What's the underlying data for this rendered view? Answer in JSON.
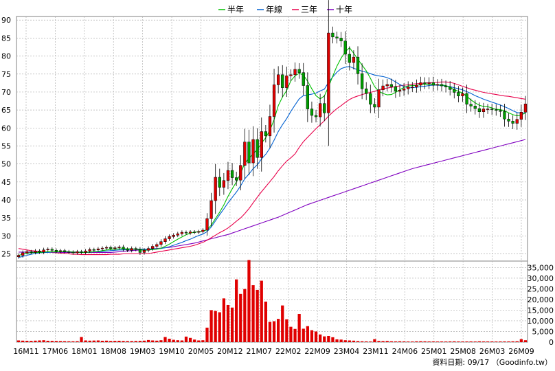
{
  "legend": [
    {
      "label": "半年",
      "color": "#00c000"
    },
    {
      "label": "年線",
      "color": "#0060d0"
    },
    {
      "label": "三年",
      "color": "#e8004a"
    },
    {
      "label": "十年",
      "color": "#8000c0"
    }
  ],
  "footer": {
    "source_label": "資料日期: 09/17 （Goodinfo.tw）"
  },
  "chart_data": {
    "type": "candlestick",
    "price_axis": {
      "range": [
        23,
        91
      ],
      "ticks": [
        25,
        30,
        35,
        40,
        45,
        50,
        55,
        60,
        65,
        70,
        75,
        80,
        85,
        90
      ]
    },
    "volume_axis": {
      "range": [
        0,
        38000
      ],
      "ticks": [
        0,
        5000,
        10000,
        15000,
        20000,
        25000,
        30000,
        35000
      ],
      "tick_labels": [
        "0",
        "5,000",
        "10,000",
        "15,000",
        "20,000",
        "25,000",
        "30,000",
        "35,000"
      ]
    },
    "x_labels": [
      "16M11",
      "17M06",
      "18M01",
      "18M08",
      "19M03",
      "19M10",
      "20M05",
      "20M12",
      "21M07",
      "22M02",
      "22M09",
      "23M04",
      "23M11",
      "24M06",
      "25M01",
      "25M08",
      "26M03",
      "26M09"
    ],
    "close": [
      24.6,
      25.3,
      25.6,
      25.4,
      25.8,
      25.5,
      26.1,
      26.3,
      26.0,
      25.7,
      25.9,
      25.6,
      25.5,
      25.3,
      25.6,
      25.4,
      25.8,
      26.2,
      26.1,
      26.4,
      26.6,
      26.8,
      26.5,
      26.7,
      26.9,
      26.3,
      26.0,
      26.5,
      26.2,
      25.4,
      26.0,
      26.5,
      27.1,
      27.6,
      28.4,
      29.2,
      29.8,
      30.2,
      30.6,
      31.0,
      30.8,
      31.1,
      31.0,
      31.2,
      31.6,
      34.8,
      39.8,
      46.3,
      43.5,
      45.4,
      48.2,
      46.2,
      45.5,
      49.6,
      56.1,
      50.3,
      56.8,
      51.8,
      59.0,
      57.8,
      63.2,
      72.0,
      74.8,
      71.2,
      74.5,
      74.8,
      76.3,
      75.4,
      71.8,
      65.3,
      63.5,
      63.1,
      66.8,
      64.2,
      86.4,
      85.3,
      85.0,
      84.2,
      80.5,
      78.2,
      79.7,
      75.1,
      70.9,
      69.6,
      66.6,
      65.8,
      70.6,
      71.7,
      72.1,
      71.5,
      70.2,
      70.5,
      70.9,
      71.4,
      71.4,
      71.9,
      72.6,
      72.3,
      72.6,
      71.9,
      72.1,
      71.7,
      71.4,
      70.7,
      69.9,
      68.9,
      69.6,
      66.6,
      66.1,
      65.4,
      64.5,
      65.3,
      65.3,
      65.1,
      64.9,
      64.6,
      62.5,
      61.9,
      61.3,
      62.4,
      64.4,
      66.7
    ],
    "ma_half_year": [
      24.6,
      24.9,
      25.2,
      25.3,
      25.4,
      25.4,
      25.5,
      25.6,
      25.6,
      25.6,
      25.6,
      25.6,
      25.6,
      25.5,
      25.5,
      25.4,
      25.4,
      25.5,
      25.6,
      25.7,
      25.9,
      26.1,
      26.2,
      26.3,
      26.4,
      26.4,
      26.4,
      26.4,
      26.3,
      26.2,
      26.0,
      26.1,
      26.2,
      26.3,
      26.6,
      27.1,
      27.7,
      28.4,
      29.1,
      29.7,
      30.3,
      30.8,
      31.0,
      31.2,
      31.3,
      31.7,
      33.0,
      34.8,
      36.6,
      38.6,
      41.0,
      43.1,
      45.0,
      47.4,
      50.2,
      51.5,
      52.9,
      54.0,
      55.8,
      57.3,
      59.4,
      62.3,
      66.2,
      68.6,
      70.4,
      73.1,
      74.5,
      75.2,
      74.7,
      73.0,
      70.9,
      69.0,
      68.1,
      68.9,
      71.5,
      74.4,
      77.2,
      79.4,
      81.2,
      82.3,
      80.8,
      79.1,
      77.5,
      75.9,
      73.8,
      71.5,
      70.2,
      69.6,
      69.2,
      69.3,
      69.9,
      70.6,
      71.3,
      71.7,
      71.8,
      71.8,
      72.1,
      72.1,
      72.1,
      72.1,
      72.0,
      72.0,
      71.8,
      71.3,
      70.7,
      70.2,
      69.7,
      68.8,
      67.8,
      67.0,
      66.3,
      66.0,
      65.9,
      65.6,
      65.2,
      65.1,
      64.8,
      64.2,
      63.7,
      63.4,
      63.6,
      64.2
    ],
    "ma_year": [
      24.0,
      24.3,
      24.6,
      24.9,
      25.1,
      25.3,
      25.4,
      25.4,
      25.5,
      25.5,
      25.6,
      25.6,
      25.6,
      25.5,
      25.5,
      25.5,
      25.5,
      25.5,
      25.6,
      25.6,
      25.7,
      25.8,
      25.9,
      26.0,
      26.1,
      26.1,
      26.2,
      26.2,
      26.3,
      26.3,
      26.3,
      26.3,
      26.3,
      26.4,
      26.5,
      26.7,
      27.0,
      27.4,
      27.8,
      28.2,
      28.7,
      29.1,
      29.6,
      30.1,
      30.5,
      31.2,
      32.5,
      34.2,
      35.9,
      37.5,
      39.2,
      40.7,
      42.2,
      43.9,
      45.9,
      47.2,
      48.7,
      49.8,
      51.4,
      52.7,
      54.4,
      56.6,
      59.0,
      60.9,
      62.6,
      64.6,
      66.4,
      68.1,
      69.0,
      69.2,
      69.4,
      69.7,
      70.3,
      70.8,
      72.7,
      74.2,
      75.5,
      76.5,
      76.9,
      77.1,
      76.6,
      76.2,
      75.8,
      75.5,
      75.1,
      74.7,
      74.5,
      74.3,
      74.0,
      73.5,
      72.8,
      72.1,
      71.5,
      71.2,
      71.2,
      71.3,
      71.5,
      71.6,
      71.8,
      71.9,
      71.9,
      71.8,
      71.7,
      71.5,
      71.2,
      70.9,
      70.6,
      70.1,
      69.6,
      69.0,
      68.5,
      68.0,
      67.6,
      67.2,
      66.8,
      66.4,
      65.9,
      65.4,
      64.8,
      64.3,
      64.1,
      64.2
    ],
    "ma_three_year": [
      26.5,
      26.3,
      26.1,
      25.9,
      25.8,
      25.7,
      25.6,
      25.5,
      25.4,
      25.3,
      25.2,
      25.1,
      25.0,
      24.9,
      24.9,
      24.8,
      24.8,
      24.8,
      24.8,
      24.8,
      24.8,
      24.8,
      24.9,
      24.9,
      24.9,
      25.0,
      25.0,
      25.0,
      25.0,
      25.0,
      25.0,
      25.1,
      25.3,
      25.5,
      25.7,
      25.9,
      26.1,
      26.3,
      26.5,
      26.7,
      26.9,
      27.1,
      27.4,
      27.8,
      28.2,
      28.8,
      29.5,
      30.2,
      30.9,
      31.5,
      32.2,
      33.1,
      34.1,
      35.0,
      36.2,
      37.6,
      39.2,
      40.8,
      42.3,
      43.7,
      45.1,
      46.5,
      48.1,
      49.5,
      50.8,
      51.7,
      52.8,
      54.6,
      56.2,
      57.4,
      58.6,
      59.8,
      60.9,
      62.0,
      63.3,
      64.4,
      65.4,
      66.2,
      67.1,
      67.9,
      68.5,
      68.9,
      69.3,
      69.6,
      69.9,
      70.2,
      70.6,
      70.9,
      71.1,
      71.3,
      71.5,
      71.7,
      71.9,
      72.0,
      72.2,
      72.3,
      72.4,
      72.5,
      72.6,
      72.6,
      72.7,
      72.8,
      72.8,
      72.7,
      72.4,
      72.0,
      71.6,
      71.2,
      70.8,
      70.5,
      70.2,
      69.9,
      69.7,
      69.5,
      69.3,
      69.1,
      68.9,
      68.8,
      68.6,
      68.4,
      68.2,
      68.0
    ],
    "ma_ten_year": [
      25.5,
      25.5,
      25.5,
      25.5,
      25.5,
      25.5,
      25.5,
      25.5,
      25.5,
      25.5,
      25.4,
      25.4,
      25.4,
      25.4,
      25.4,
      25.4,
      25.4,
      25.4,
      25.4,
      25.4,
      25.4,
      25.4,
      25.4,
      25.5,
      25.6,
      25.7,
      25.8,
      25.9,
      26.0,
      26.1,
      26.2,
      26.3,
      26.4,
      26.5,
      26.6,
      26.7,
      26.8,
      27.0,
      27.2,
      27.4,
      27.6,
      27.8,
      28.0,
      28.3,
      28.6,
      28.9,
      29.2,
      29.5,
      29.8,
      30.1,
      30.4,
      30.8,
      31.2,
      31.6,
      32.0,
      32.4,
      32.8,
      33.2,
      33.6,
      34.0,
      34.4,
      34.8,
      35.2,
      35.7,
      36.2,
      36.7,
      37.2,
      37.7,
      38.2,
      38.7,
      39.1,
      39.5,
      39.9,
      40.3,
      40.7,
      41.1,
      41.5,
      41.9,
      42.3,
      42.7,
      43.1,
      43.5,
      43.9,
      44.3,
      44.7,
      45.1,
      45.5,
      45.9,
      46.3,
      46.7,
      47.1,
      47.5,
      47.9,
      48.3,
      48.7,
      49.0,
      49.3,
      49.6,
      49.9,
      50.2,
      50.5,
      50.8,
      51.1,
      51.4,
      51.7,
      52.0,
      52.3,
      52.6,
      52.9,
      53.2,
      53.5,
      53.8,
      54.1,
      54.4,
      54.7,
      55.0,
      55.3,
      55.6,
      55.9,
      56.2,
      56.5,
      56.8
    ],
    "volume": [
      800,
      700,
      650,
      600,
      700,
      800,
      900,
      650,
      600,
      550,
      500,
      450,
      400,
      400,
      450,
      2400,
      800,
      700,
      750,
      800,
      650,
      700,
      550,
      600,
      650,
      550,
      500,
      500,
      550,
      600,
      700,
      1000,
      800,
      700,
      900,
      2400,
      1600,
      1100,
      900,
      800,
      2600,
      2000,
      1200,
      800,
      900,
      6800,
      15000,
      14600,
      14000,
      20500,
      17400,
      16200,
      29400,
      22600,
      24900,
      38500,
      26700,
      24500,
      28800,
      19000,
      9500,
      9800,
      10900,
      17200,
      10700,
      7200,
      6200,
      13200,
      6300,
      7500,
      5600,
      5000,
      3600,
      2700,
      2900,
      2300,
      1300,
      1200,
      900,
      800,
      700,
      500,
      400,
      350,
      300,
      1400,
      550,
      500,
      550,
      400,
      350,
      400,
      350,
      300,
      300,
      380,
      420,
      380,
      320,
      330,
      300,
      320,
      300,
      350,
      380,
      320,
      300,
      320,
      330,
      300,
      380,
      330,
      320,
      320,
      300,
      320,
      330,
      340,
      380,
      420,
      1400,
      900
    ]
  }
}
